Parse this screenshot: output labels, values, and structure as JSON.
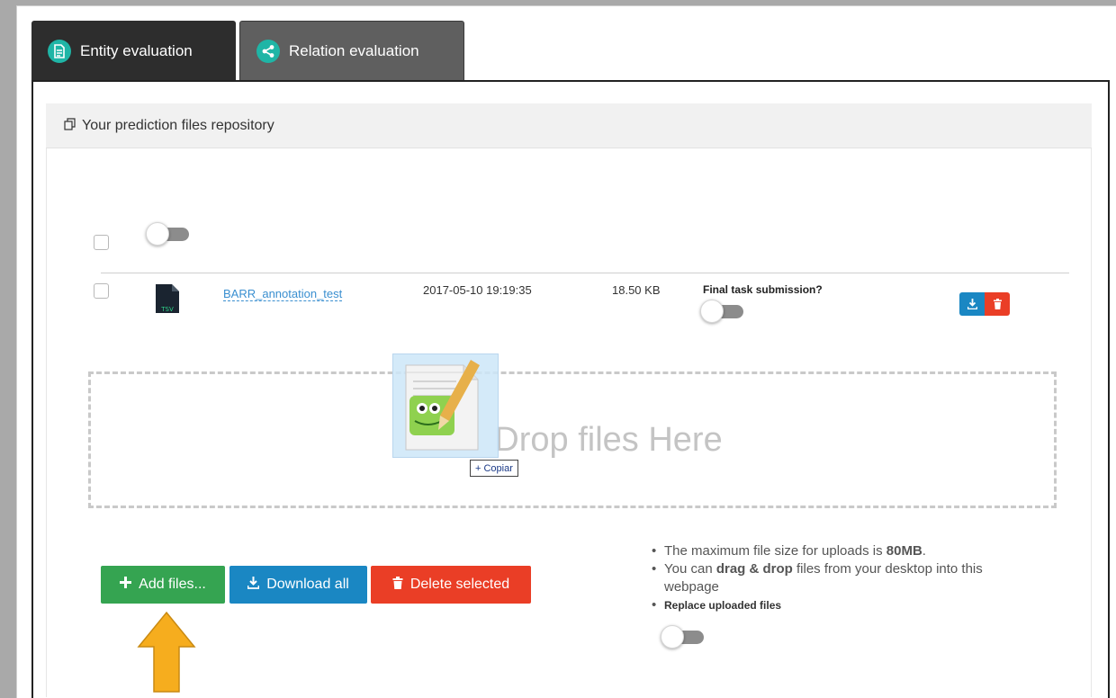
{
  "tabs": [
    {
      "label": "Entity evaluation",
      "icon": "document-icon",
      "active": true
    },
    {
      "label": "Relation evaluation",
      "icon": "share-icon",
      "active": false
    }
  ],
  "repository": {
    "title": "Your prediction files repository",
    "icon": "copy-icon"
  },
  "file": {
    "name": "BARR_annotation_test",
    "type": "TSV",
    "date": "2017-05-10 19:19:35",
    "size": "18.50 KB",
    "final_label": "Final task submission?"
  },
  "dropzone": {
    "text": "Drop files Here",
    "drag_badge": "+ Copiar",
    "drag_icon": "notepad-plus-plus-icon"
  },
  "buttons": {
    "add": "Add files...",
    "download_all": "Download all",
    "delete_selected": "Delete selected"
  },
  "info": {
    "max_prefix": "The maximum file size for uploads is ",
    "max_size": "80MB",
    "max_suffix": ".",
    "drag_prefix": "You can ",
    "drag_bold": "drag & drop",
    "drag_suffix": " files from your desktop into this webpage",
    "replace_label": "Replace uploaded files"
  },
  "colors": {
    "accent_teal": "#1fb5a6",
    "add_green": "#35a451",
    "download_blue": "#1a87c3",
    "delete_red": "#ea3e26",
    "arrow_orange": "#f6ad1e"
  }
}
